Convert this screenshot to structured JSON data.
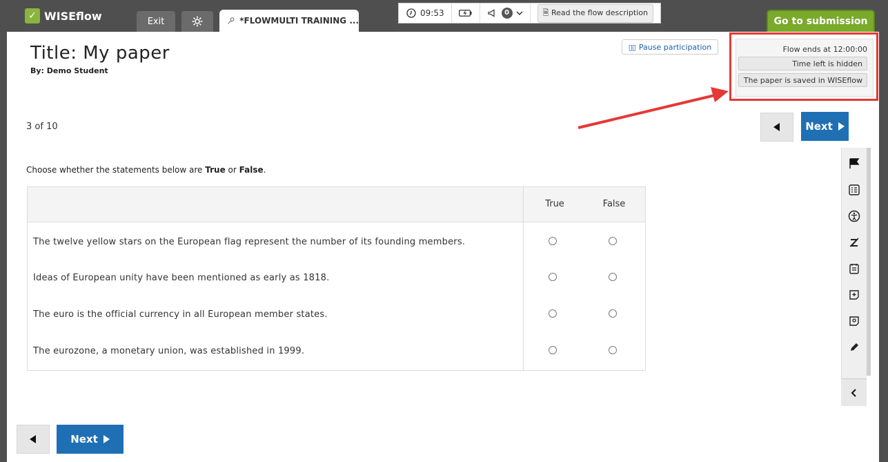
{
  "topbar": {
    "app_name": "WISEflow",
    "exit_label": "Exit",
    "flow_tab_label": "*FLOWMULTI TRAINING ...",
    "clock_time": "09:53",
    "announcements_count": "0",
    "read_description_label": "Read the flow description",
    "go_to_submission_label": "Go to submission"
  },
  "paper": {
    "title": "Title: My paper",
    "author": "By: Demo Student",
    "pause_label": "Pause participation"
  },
  "status_panel": {
    "flow_ends": "Flow ends at 12:00:00",
    "time_left": "Time left is hidden",
    "saved": "The paper is saved in WISEflow"
  },
  "navigation": {
    "page_counter": "3 of 10",
    "next_label": "Next"
  },
  "question": {
    "instruction_prefix": "Choose whether the statements below are ",
    "instruction_true": "True",
    "instruction_or": " or ",
    "instruction_false": "False",
    "instruction_suffix": ".",
    "column_true": "True",
    "column_false": "False",
    "statements": [
      "The twelve yellow stars on the European flag represent the number of its founding members.",
      "Ideas of European unity have been mentioned as early as 1818.",
      "The euro is the official currency in all European member states.",
      "The eurozone, a monetary union, was established in 1999."
    ]
  },
  "colors": {
    "topbar": "#4f4f4f",
    "brand_green": "#7aa92b",
    "primary_blue": "#1f6fb5",
    "annotation_red": "#e53935"
  },
  "tools": [
    "flag-icon",
    "list-icon",
    "accessibility-icon",
    "spelling-icon",
    "notepad-icon",
    "add-note-icon",
    "comment-icon",
    "pencil-icon",
    "chevron-left-icon"
  ]
}
